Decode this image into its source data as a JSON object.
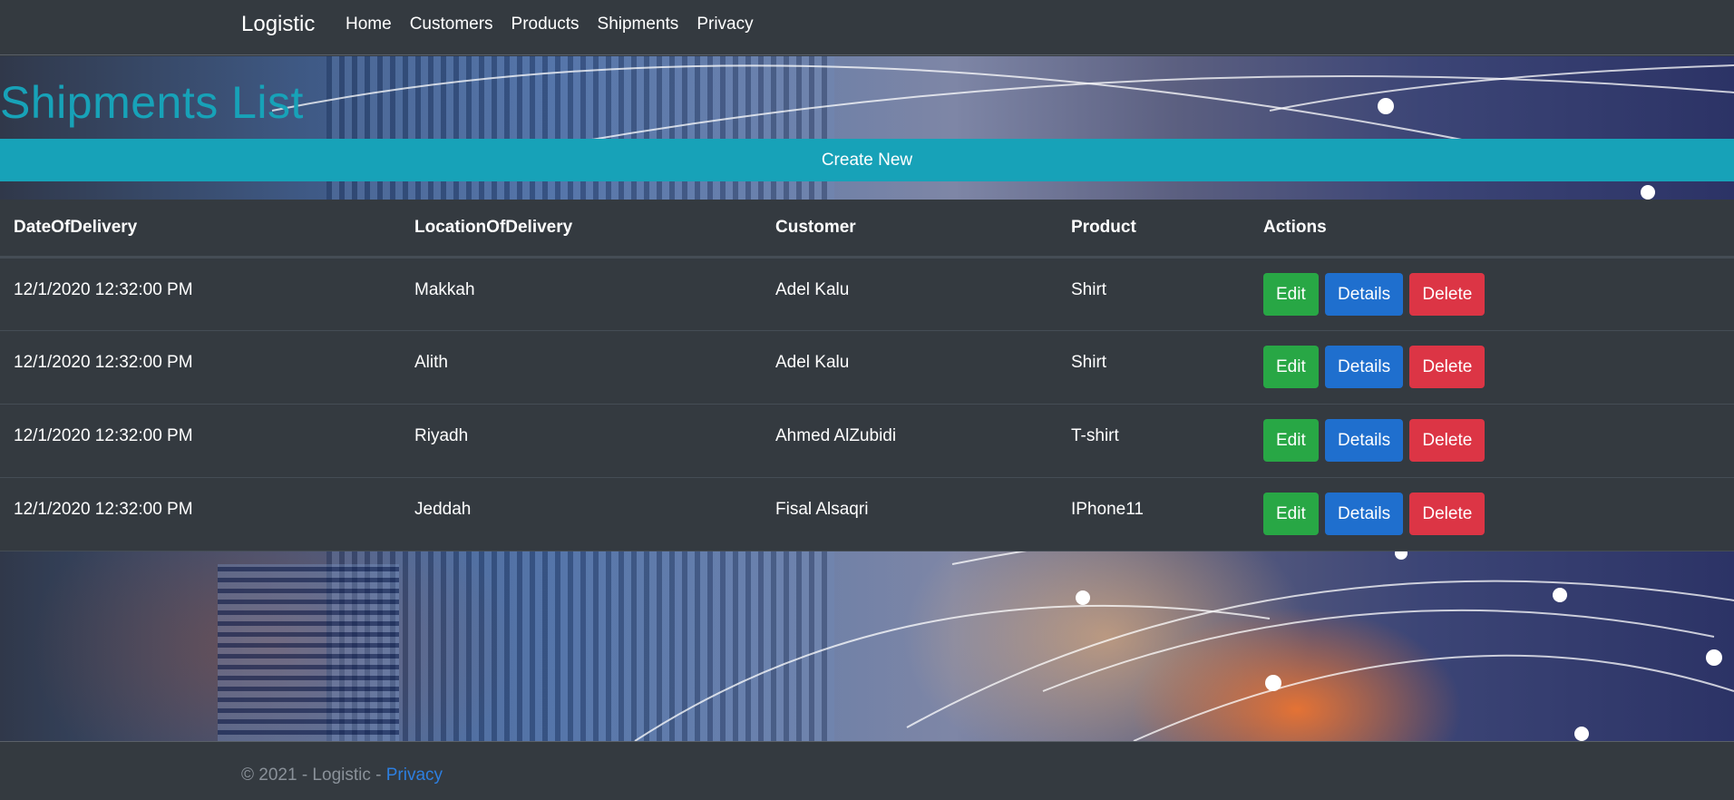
{
  "navbar": {
    "brand": "Logistic",
    "links": [
      "Home",
      "Customers",
      "Products",
      "Shipments",
      "Privacy"
    ]
  },
  "page": {
    "title": "Shipments List",
    "create_label": "Create New"
  },
  "table": {
    "columns": [
      "DateOfDelivery",
      "LocationOfDelivery",
      "Customer",
      "Product",
      "Actions"
    ],
    "rows": [
      {
        "date": "12/1/2020 12:32:00 PM",
        "location": "Makkah",
        "customer": "Adel Kalu",
        "product": "Shirt"
      },
      {
        "date": "12/1/2020 12:32:00 PM",
        "location": "Alith",
        "customer": "Adel Kalu",
        "product": "Shirt"
      },
      {
        "date": "12/1/2020 12:32:00 PM",
        "location": "Riyadh",
        "customer": "Ahmed AlZubidi",
        "product": "T-shirt"
      },
      {
        "date": "12/1/2020 12:32:00 PM",
        "location": "Jeddah",
        "customer": "Fisal Alsaqri",
        "product": "IPhone11"
      }
    ],
    "actions": {
      "edit": "Edit",
      "details": "Details",
      "delete": "Delete"
    }
  },
  "footer": {
    "text": "© 2021 - Logistic - ",
    "link": "Privacy"
  },
  "colors": {
    "accent": "#17a2b8",
    "edit": "#28a745",
    "details": "#1f6fce",
    "delete": "#dc3545",
    "background": "#343a40"
  }
}
